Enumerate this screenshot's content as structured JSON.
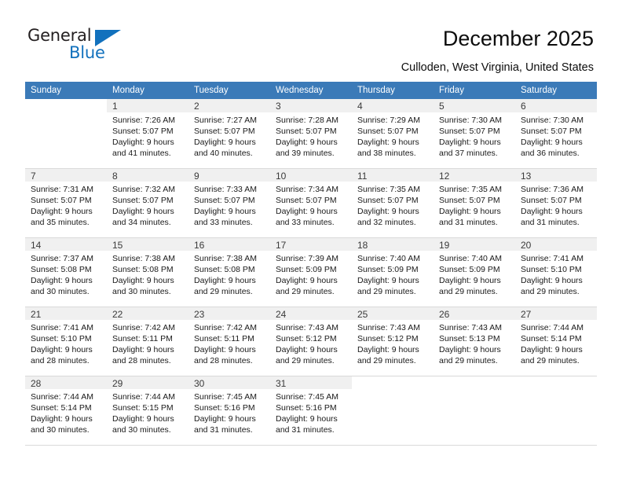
{
  "brand": {
    "name_part1": "General",
    "name_part2": "Blue",
    "triangle_color": "#1271bd",
    "text_color": "#231f20"
  },
  "header": {
    "title": "December 2025",
    "subtitle": "Culloden, West Virginia, United States"
  },
  "theme": {
    "header_bg": "#3b7ab8",
    "header_text": "#ffffff",
    "daynum_bg": "#f0f0f0",
    "cell_bg": "#ffffff",
    "border": "#d9d9d9"
  },
  "calendar": {
    "weekdays": [
      "Sunday",
      "Monday",
      "Tuesday",
      "Wednesday",
      "Thursday",
      "Friday",
      "Saturday"
    ],
    "weeks": [
      [
        {
          "day": "",
          "sunrise": "",
          "sunset": "",
          "daylight1": "",
          "daylight2": "",
          "empty": true
        },
        {
          "day": "1",
          "sunrise": "Sunrise: 7:26 AM",
          "sunset": "Sunset: 5:07 PM",
          "daylight1": "Daylight: 9 hours",
          "daylight2": "and 41 minutes."
        },
        {
          "day": "2",
          "sunrise": "Sunrise: 7:27 AM",
          "sunset": "Sunset: 5:07 PM",
          "daylight1": "Daylight: 9 hours",
          "daylight2": "and 40 minutes."
        },
        {
          "day": "3",
          "sunrise": "Sunrise: 7:28 AM",
          "sunset": "Sunset: 5:07 PM",
          "daylight1": "Daylight: 9 hours",
          "daylight2": "and 39 minutes."
        },
        {
          "day": "4",
          "sunrise": "Sunrise: 7:29 AM",
          "sunset": "Sunset: 5:07 PM",
          "daylight1": "Daylight: 9 hours",
          "daylight2": "and 38 minutes."
        },
        {
          "day": "5",
          "sunrise": "Sunrise: 7:30 AM",
          "sunset": "Sunset: 5:07 PM",
          "daylight1": "Daylight: 9 hours",
          "daylight2": "and 37 minutes."
        },
        {
          "day": "6",
          "sunrise": "Sunrise: 7:30 AM",
          "sunset": "Sunset: 5:07 PM",
          "daylight1": "Daylight: 9 hours",
          "daylight2": "and 36 minutes."
        }
      ],
      [
        {
          "day": "7",
          "sunrise": "Sunrise: 7:31 AM",
          "sunset": "Sunset: 5:07 PM",
          "daylight1": "Daylight: 9 hours",
          "daylight2": "and 35 minutes."
        },
        {
          "day": "8",
          "sunrise": "Sunrise: 7:32 AM",
          "sunset": "Sunset: 5:07 PM",
          "daylight1": "Daylight: 9 hours",
          "daylight2": "and 34 minutes."
        },
        {
          "day": "9",
          "sunrise": "Sunrise: 7:33 AM",
          "sunset": "Sunset: 5:07 PM",
          "daylight1": "Daylight: 9 hours",
          "daylight2": "and 33 minutes."
        },
        {
          "day": "10",
          "sunrise": "Sunrise: 7:34 AM",
          "sunset": "Sunset: 5:07 PM",
          "daylight1": "Daylight: 9 hours",
          "daylight2": "and 33 minutes."
        },
        {
          "day": "11",
          "sunrise": "Sunrise: 7:35 AM",
          "sunset": "Sunset: 5:07 PM",
          "daylight1": "Daylight: 9 hours",
          "daylight2": "and 32 minutes."
        },
        {
          "day": "12",
          "sunrise": "Sunrise: 7:35 AM",
          "sunset": "Sunset: 5:07 PM",
          "daylight1": "Daylight: 9 hours",
          "daylight2": "and 31 minutes."
        },
        {
          "day": "13",
          "sunrise": "Sunrise: 7:36 AM",
          "sunset": "Sunset: 5:07 PM",
          "daylight1": "Daylight: 9 hours",
          "daylight2": "and 31 minutes."
        }
      ],
      [
        {
          "day": "14",
          "sunrise": "Sunrise: 7:37 AM",
          "sunset": "Sunset: 5:08 PM",
          "daylight1": "Daylight: 9 hours",
          "daylight2": "and 30 minutes."
        },
        {
          "day": "15",
          "sunrise": "Sunrise: 7:38 AM",
          "sunset": "Sunset: 5:08 PM",
          "daylight1": "Daylight: 9 hours",
          "daylight2": "and 30 minutes."
        },
        {
          "day": "16",
          "sunrise": "Sunrise: 7:38 AM",
          "sunset": "Sunset: 5:08 PM",
          "daylight1": "Daylight: 9 hours",
          "daylight2": "and 29 minutes."
        },
        {
          "day": "17",
          "sunrise": "Sunrise: 7:39 AM",
          "sunset": "Sunset: 5:09 PM",
          "daylight1": "Daylight: 9 hours",
          "daylight2": "and 29 minutes."
        },
        {
          "day": "18",
          "sunrise": "Sunrise: 7:40 AM",
          "sunset": "Sunset: 5:09 PM",
          "daylight1": "Daylight: 9 hours",
          "daylight2": "and 29 minutes."
        },
        {
          "day": "19",
          "sunrise": "Sunrise: 7:40 AM",
          "sunset": "Sunset: 5:09 PM",
          "daylight1": "Daylight: 9 hours",
          "daylight2": "and 29 minutes."
        },
        {
          "day": "20",
          "sunrise": "Sunrise: 7:41 AM",
          "sunset": "Sunset: 5:10 PM",
          "daylight1": "Daylight: 9 hours",
          "daylight2": "and 29 minutes."
        }
      ],
      [
        {
          "day": "21",
          "sunrise": "Sunrise: 7:41 AM",
          "sunset": "Sunset: 5:10 PM",
          "daylight1": "Daylight: 9 hours",
          "daylight2": "and 28 minutes."
        },
        {
          "day": "22",
          "sunrise": "Sunrise: 7:42 AM",
          "sunset": "Sunset: 5:11 PM",
          "daylight1": "Daylight: 9 hours",
          "daylight2": "and 28 minutes."
        },
        {
          "day": "23",
          "sunrise": "Sunrise: 7:42 AM",
          "sunset": "Sunset: 5:11 PM",
          "daylight1": "Daylight: 9 hours",
          "daylight2": "and 28 minutes."
        },
        {
          "day": "24",
          "sunrise": "Sunrise: 7:43 AM",
          "sunset": "Sunset: 5:12 PM",
          "daylight1": "Daylight: 9 hours",
          "daylight2": "and 29 minutes."
        },
        {
          "day": "25",
          "sunrise": "Sunrise: 7:43 AM",
          "sunset": "Sunset: 5:12 PM",
          "daylight1": "Daylight: 9 hours",
          "daylight2": "and 29 minutes."
        },
        {
          "day": "26",
          "sunrise": "Sunrise: 7:43 AM",
          "sunset": "Sunset: 5:13 PM",
          "daylight1": "Daylight: 9 hours",
          "daylight2": "and 29 minutes."
        },
        {
          "day": "27",
          "sunrise": "Sunrise: 7:44 AM",
          "sunset": "Sunset: 5:14 PM",
          "daylight1": "Daylight: 9 hours",
          "daylight2": "and 29 minutes."
        }
      ],
      [
        {
          "day": "28",
          "sunrise": "Sunrise: 7:44 AM",
          "sunset": "Sunset: 5:14 PM",
          "daylight1": "Daylight: 9 hours",
          "daylight2": "and 30 minutes."
        },
        {
          "day": "29",
          "sunrise": "Sunrise: 7:44 AM",
          "sunset": "Sunset: 5:15 PM",
          "daylight1": "Daylight: 9 hours",
          "daylight2": "and 30 minutes."
        },
        {
          "day": "30",
          "sunrise": "Sunrise: 7:45 AM",
          "sunset": "Sunset: 5:16 PM",
          "daylight1": "Daylight: 9 hours",
          "daylight2": "and 31 minutes."
        },
        {
          "day": "31",
          "sunrise": "Sunrise: 7:45 AM",
          "sunset": "Sunset: 5:16 PM",
          "daylight1": "Daylight: 9 hours",
          "daylight2": "and 31 minutes."
        },
        {
          "day": "",
          "sunrise": "",
          "sunset": "",
          "daylight1": "",
          "daylight2": "",
          "empty": true
        },
        {
          "day": "",
          "sunrise": "",
          "sunset": "",
          "daylight1": "",
          "daylight2": "",
          "empty": true
        },
        {
          "day": "",
          "sunrise": "",
          "sunset": "",
          "daylight1": "",
          "daylight2": "",
          "empty": true
        }
      ]
    ]
  }
}
